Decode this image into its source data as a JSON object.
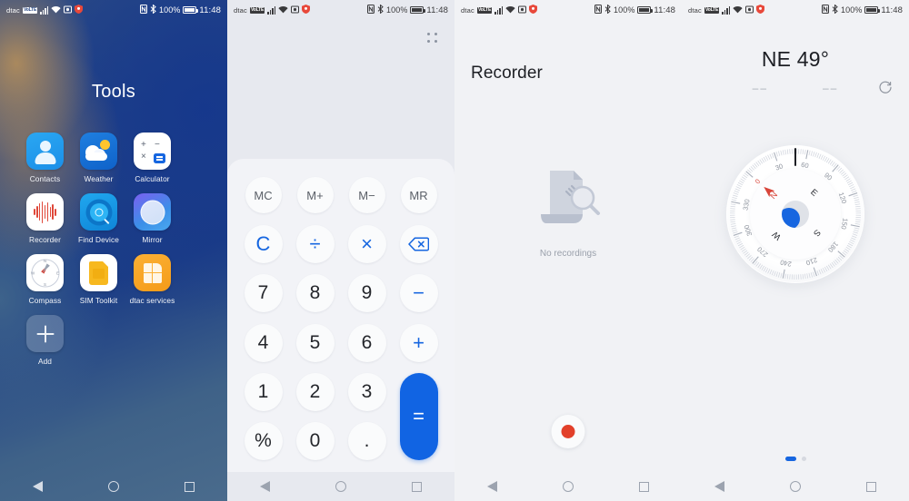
{
  "statusbar": {
    "carrier": "dtac",
    "volte_badge": "VoLTE",
    "icons": [
      "signal-bars-icon",
      "wifi-icon",
      "screenshot-icon",
      "security-shield-icon",
      "nfc-icon",
      "bluetooth-icon"
    ],
    "battery_percent": "100%",
    "clock": "11:48"
  },
  "navbar": {
    "back": "back-button",
    "home": "home-button",
    "recents": "recents-button"
  },
  "home": {
    "folder_title": "Tools",
    "apps": [
      {
        "label": "Contacts",
        "icon": "contacts-icon"
      },
      {
        "label": "Weather",
        "icon": "weather-icon"
      },
      {
        "label": "Calculator",
        "icon": "calculator-icon"
      },
      {
        "label": "Recorder",
        "icon": "recorder-icon"
      },
      {
        "label": "Find Device",
        "icon": "find-device-icon"
      },
      {
        "label": "Mirror",
        "icon": "mirror-icon"
      },
      {
        "label": "Compass",
        "icon": "compass-icon"
      },
      {
        "label": "SIM Toolkit",
        "icon": "sim-toolkit-icon"
      },
      {
        "label": "dtac services",
        "icon": "dtac-services-icon"
      },
      {
        "label": "Add",
        "icon": "add-icon"
      }
    ]
  },
  "calculator": {
    "menu_icon": "four-dot-menu-icon",
    "display_value": "",
    "keys": [
      {
        "label": "MC",
        "type": "mem"
      },
      {
        "label": "M+",
        "type": "mem"
      },
      {
        "label": "M−",
        "type": "mem"
      },
      {
        "label": "MR",
        "type": "mem"
      },
      {
        "label": "C",
        "type": "op"
      },
      {
        "label": "÷",
        "type": "op"
      },
      {
        "label": "×",
        "type": "op"
      },
      {
        "label": "backspace-icon",
        "type": "backspace"
      },
      {
        "label": "7",
        "type": "num"
      },
      {
        "label": "8",
        "type": "num"
      },
      {
        "label": "9",
        "type": "num"
      },
      {
        "label": "−",
        "type": "op"
      },
      {
        "label": "4",
        "type": "num"
      },
      {
        "label": "5",
        "type": "num"
      },
      {
        "label": "6",
        "type": "num"
      },
      {
        "label": "+",
        "type": "op"
      },
      {
        "label": "1",
        "type": "num"
      },
      {
        "label": "2",
        "type": "num"
      },
      {
        "label": "3",
        "type": "num"
      },
      {
        "label": "=",
        "type": "equals"
      },
      {
        "label": "%",
        "type": "num"
      },
      {
        "label": "0",
        "type": "num"
      },
      {
        "label": ".",
        "type": "num"
      }
    ]
  },
  "recorder": {
    "title": "Recorder",
    "empty_state_text": "No recordings",
    "empty_state_icon": "document-search-icon",
    "record_button": "record-button"
  },
  "compass": {
    "heading": "NE 49°",
    "heading_degrees": 49,
    "latitude": "––",
    "longitude": "––",
    "refresh_icon": "refresh-icon",
    "cardinals": [
      "N",
      "E",
      "S",
      "W"
    ],
    "degree_labels": [
      "0",
      "30",
      "60",
      "90",
      "120",
      "150",
      "180",
      "210",
      "240",
      "270",
      "300",
      "330"
    ],
    "page_indicator": {
      "total": 2,
      "active": 1
    }
  },
  "colors": {
    "accent_blue": "#1166e3",
    "record_red": "#e2402a",
    "needle_red": "#d8453a",
    "light_bg": "#f1f2f5"
  }
}
